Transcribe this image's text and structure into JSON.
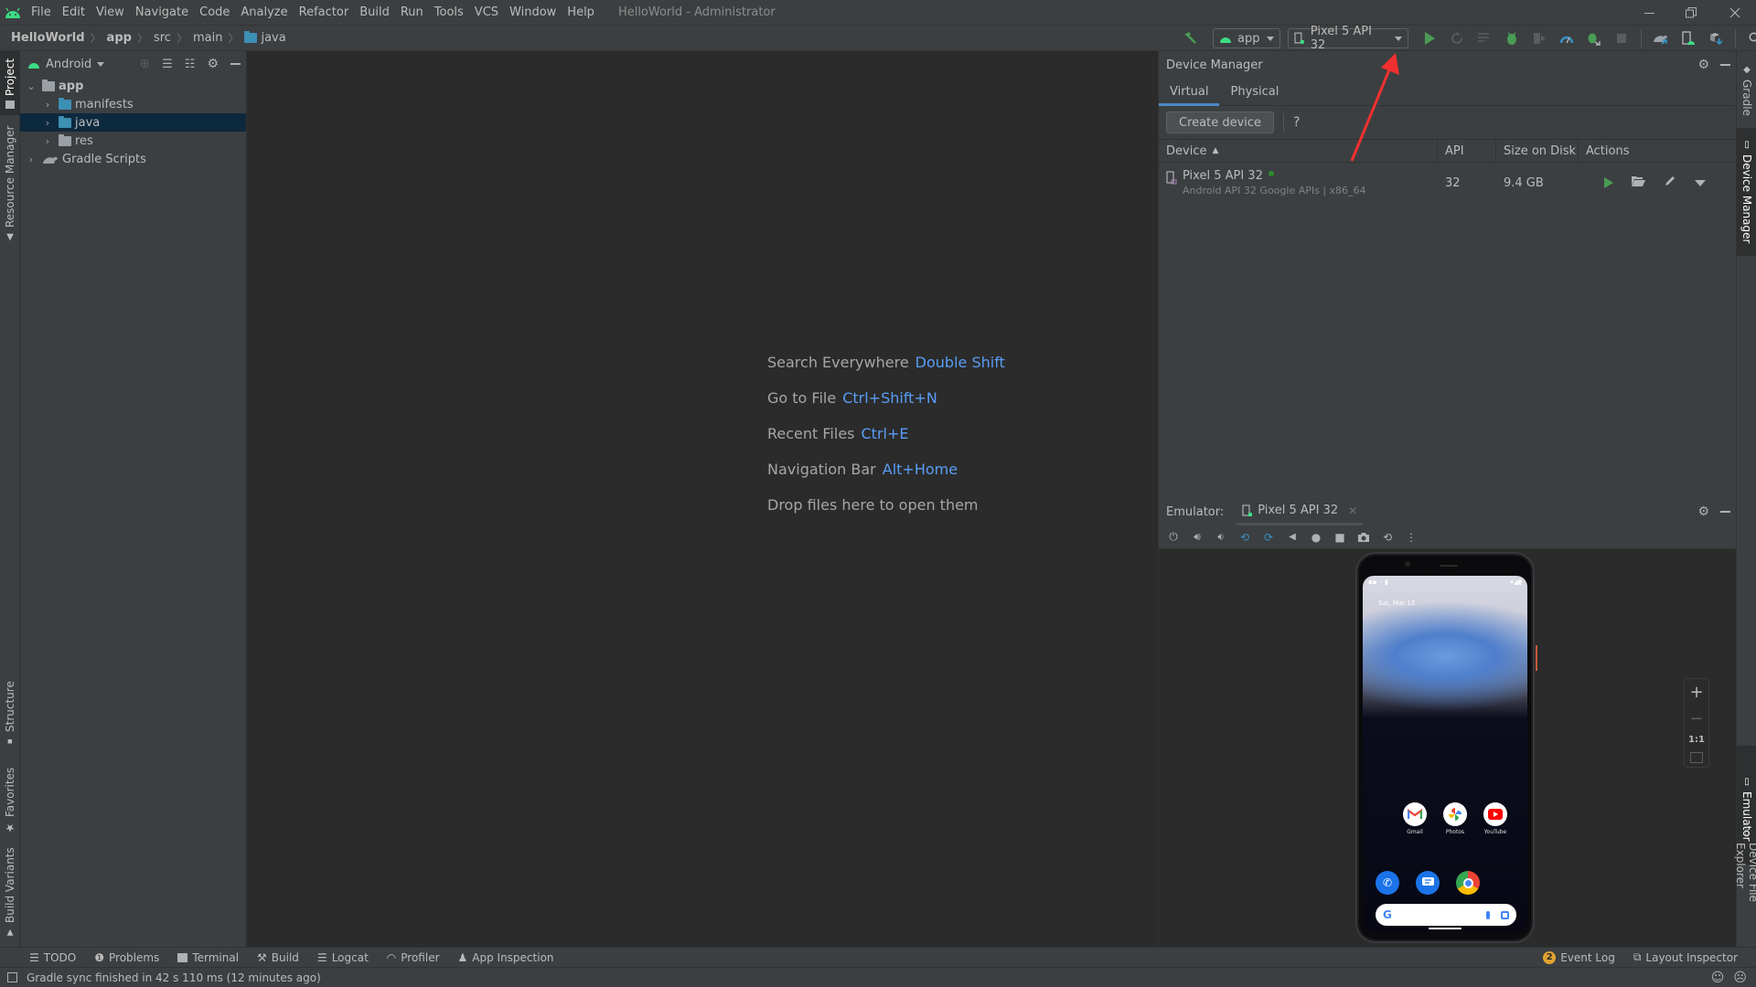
{
  "menu": {
    "items": [
      "File",
      "Edit",
      "View",
      "Navigate",
      "Code",
      "Analyze",
      "Refactor",
      "Build",
      "Run",
      "Tools",
      "VCS",
      "Window",
      "Help"
    ],
    "window_title": "HelloWorld - Administrator"
  },
  "breadcrumb": {
    "items": [
      "HelloWorld",
      "app",
      "src",
      "main",
      "java"
    ]
  },
  "toolbar": {
    "run_config": "app",
    "device": "Pixel 5 API 32"
  },
  "left_strip": {
    "tabs": [
      "Project",
      "Resource Manager",
      "Structure",
      "Favorites",
      "Build Variants"
    ]
  },
  "project": {
    "view_mode": "Android",
    "tree": [
      {
        "label": "app",
        "expanded": true
      },
      {
        "label": "manifests",
        "expanded": false
      },
      {
        "label": "java",
        "expanded": false,
        "selected": true
      },
      {
        "label": "res",
        "expanded": false
      },
      {
        "label": "Gradle Scripts",
        "expanded": false
      }
    ]
  },
  "editor": {
    "hints": [
      {
        "label": "Search Everywhere",
        "key": "Double Shift"
      },
      {
        "label": "Go to File",
        "key": "Ctrl+Shift+N"
      },
      {
        "label": "Recent Files",
        "key": "Ctrl+E"
      },
      {
        "label": "Navigation Bar",
        "key": "Alt+Home"
      },
      {
        "label": "Drop files here to open them",
        "key": ""
      }
    ]
  },
  "device_manager": {
    "title": "Device Manager",
    "tabs": [
      "Virtual",
      "Physical"
    ],
    "active_tab": "Virtual",
    "create_button": "Create device",
    "help": "?",
    "columns": [
      "Device",
      "API",
      "Size on Disk",
      "Actions"
    ],
    "rows": [
      {
        "name": "Pixel 5 API 32",
        "subtitle": "Android API 32 Google APIs | x86_64",
        "api": "32",
        "size": "9.4 GB",
        "online": true
      }
    ]
  },
  "emulator": {
    "label": "Emulator:",
    "tab": "Pixel 5 API 32",
    "phone": {
      "date": "Sat, Mar 12",
      "apps_row1": [
        "Gmail",
        "Photos",
        "YouTube"
      ],
      "zoom_ratio": "1:1"
    }
  },
  "right_strip": {
    "tabs": [
      "Gradle",
      "Device Manager",
      "Emulator",
      "Device File Explorer"
    ]
  },
  "bottom_tools": {
    "left": [
      "TODO",
      "Problems",
      "Terminal",
      "Build",
      "Logcat",
      "Profiler",
      "App Inspection"
    ],
    "event_log": "Event Log",
    "event_count": "2",
    "layout_inspector": "Layout Inspector"
  },
  "status": {
    "message": "Gradle sync finished in 42 s 110 ms (12 minutes ago)"
  },
  "colors": {
    "accent": "#4a88c7",
    "run_green": "#499c54",
    "android_green": "#3ddc84",
    "shortcut_blue": "#589df6",
    "annotation_red": "#f03030"
  }
}
